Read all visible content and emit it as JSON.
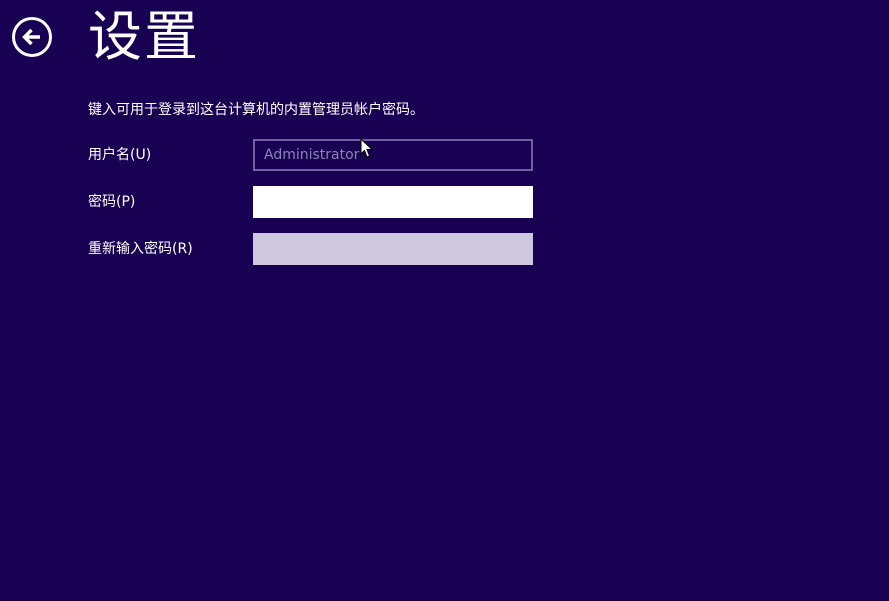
{
  "header": {
    "title": "设置",
    "back_icon": "back-arrow-icon"
  },
  "form": {
    "instructions": "键入可用于登录到这台计算机的内置管理员帐户密码。",
    "username": {
      "label": "用户名(U)",
      "placeholder": "Administrator",
      "value": ""
    },
    "password": {
      "label": "密码(P)",
      "value": ""
    },
    "reenter_password": {
      "label": "重新输入密码(R)",
      "value": ""
    }
  },
  "colors": {
    "background": "#180052",
    "text": "#ffffff",
    "input_active": "#ffffff",
    "input_disabled": "#cec8df",
    "input_readonly_border": "#6f60a0"
  }
}
